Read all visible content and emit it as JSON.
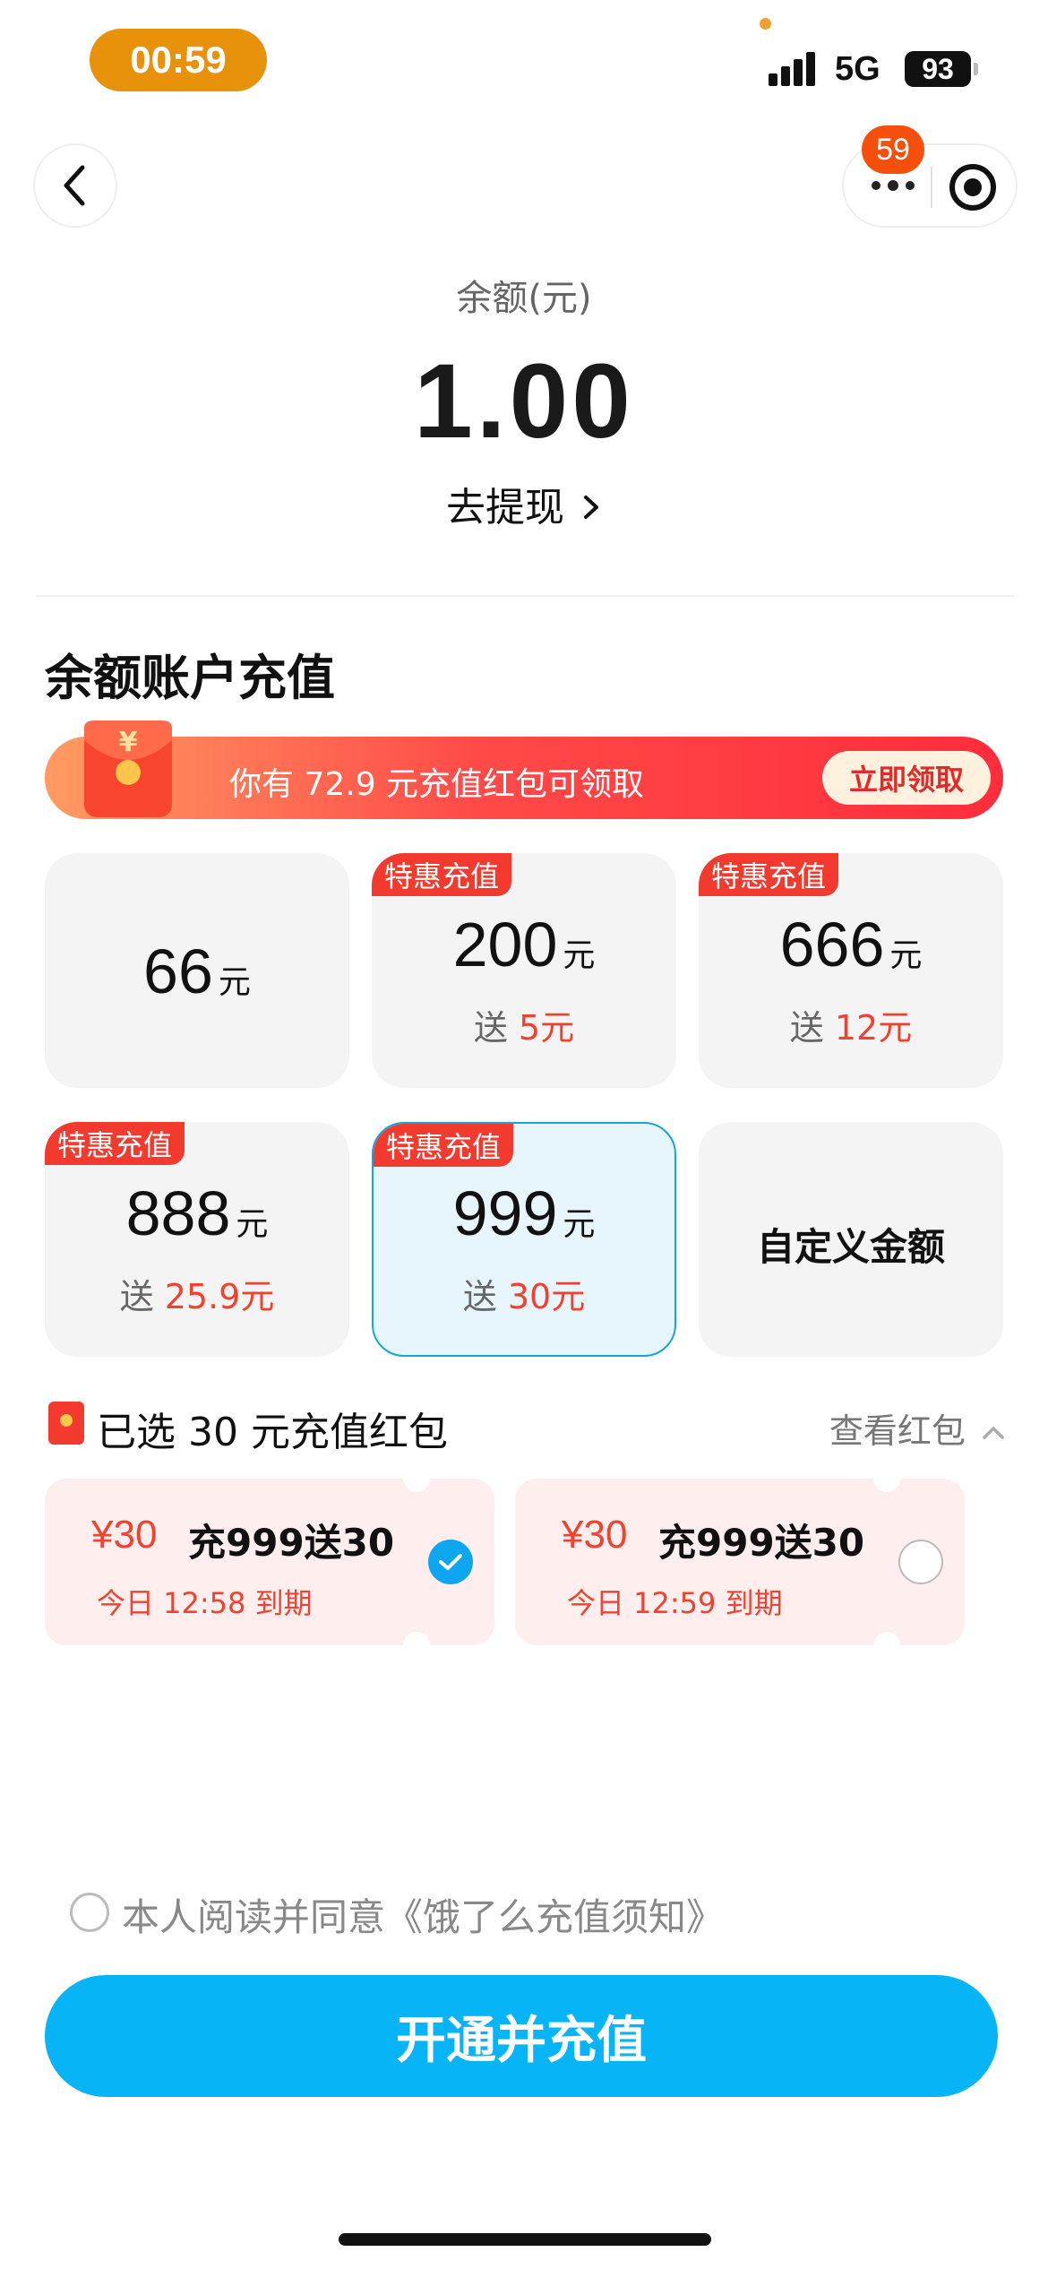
{
  "status_bar": {
    "time": "00:59",
    "network": "5G",
    "battery": "93"
  },
  "nav": {
    "back_icon": "chevron-left-icon",
    "more_icon": "more-dots-icon",
    "close_icon": "target-icon",
    "notification_count": "59"
  },
  "balance": {
    "label": "余额(元)",
    "value": "1.00",
    "withdraw_label": "去提现",
    "withdraw_icon": "chevron-right-icon"
  },
  "recharge": {
    "title": "余额账户充值",
    "banner": {
      "text": "你有 72.9 元充值红包可领取",
      "button": "立即领取",
      "icon": "red-envelope-icon"
    },
    "options": [
      {
        "amount": "66",
        "unit": "元",
        "tag": "",
        "bonus_prefix": "",
        "bonus": "",
        "selected": false
      },
      {
        "amount": "200",
        "unit": "元",
        "tag": "特惠充值",
        "bonus_prefix": "送",
        "bonus": "5元",
        "selected": false
      },
      {
        "amount": "666",
        "unit": "元",
        "tag": "特惠充值",
        "bonus_prefix": "送",
        "bonus": "12元",
        "selected": false
      },
      {
        "amount": "888",
        "unit": "元",
        "tag": "特惠充值",
        "bonus_prefix": "送",
        "bonus": "25.9元",
        "selected": false
      },
      {
        "amount": "999",
        "unit": "元",
        "tag": "特惠充值",
        "bonus_prefix": "送",
        "bonus": "30元",
        "selected": true
      },
      {
        "custom_label": "自定义金额",
        "selected": false
      }
    ]
  },
  "coupons": {
    "selected_text": "已选 30 元充值红包",
    "view_label": "查看红包",
    "view_icon": "chevron-up-icon",
    "items": [
      {
        "amount": "¥30",
        "name": "充999送30",
        "expiry": "今日 12:58 到期",
        "checked": true
      },
      {
        "amount": "¥30",
        "name": "充999送30",
        "expiry": "今日 12:59 到期",
        "checked": false
      }
    ]
  },
  "agreement": {
    "text": "本人阅读并同意《饿了么充值须知》",
    "checked": false
  },
  "submit_label": "开通并充值",
  "colors": {
    "accent_blue": "#07B4F5",
    "promo_red": "#F23A2E",
    "time_pill": "#E8910A",
    "badge": "#F4500C"
  }
}
